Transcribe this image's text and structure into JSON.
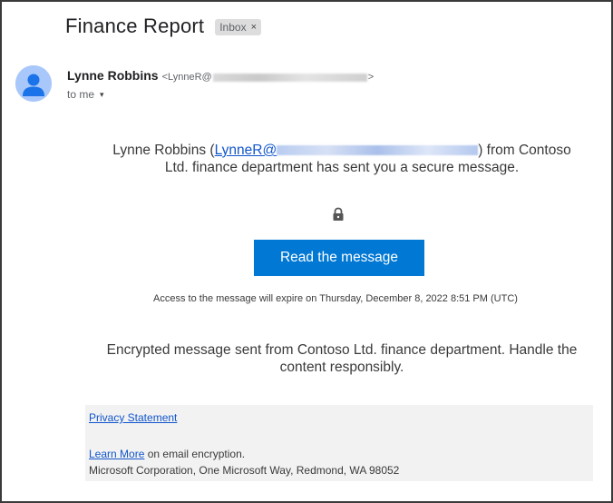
{
  "email": {
    "subject": "Finance Report",
    "label": "Inbox",
    "label_close": "×",
    "sender_name": "Lynne Robbins",
    "sender_email_prefix": "<LynneR@",
    "sender_email_suffix": ">",
    "to_text": "to me",
    "to_caret": "▾"
  },
  "body": {
    "intro_prefix": "Lynne Robbins (",
    "intro_link_text": "LynneR@",
    "intro_suffix": ") from Contoso Ltd. finance department has sent you a secure message.",
    "button_label": "Read the message",
    "expire_text": "Access to the message will expire on Thursday, December 8, 2022 8:51 PM (UTC)",
    "encrypted_note": "Encrypted message sent from Contoso Ltd. finance department. Handle the content responsibly."
  },
  "footer": {
    "privacy_link": "Privacy Statement",
    "learn_more_link": "Learn More",
    "learn_more_suffix": " on email encryption.",
    "address": "Microsoft Corporation, One Microsoft Way, Redmond, WA 98052"
  },
  "colors": {
    "button_bg": "#0078d4",
    "link": "#1155cc",
    "avatar_bg": "#a8c7fa",
    "avatar_fg": "#1a73e8"
  }
}
